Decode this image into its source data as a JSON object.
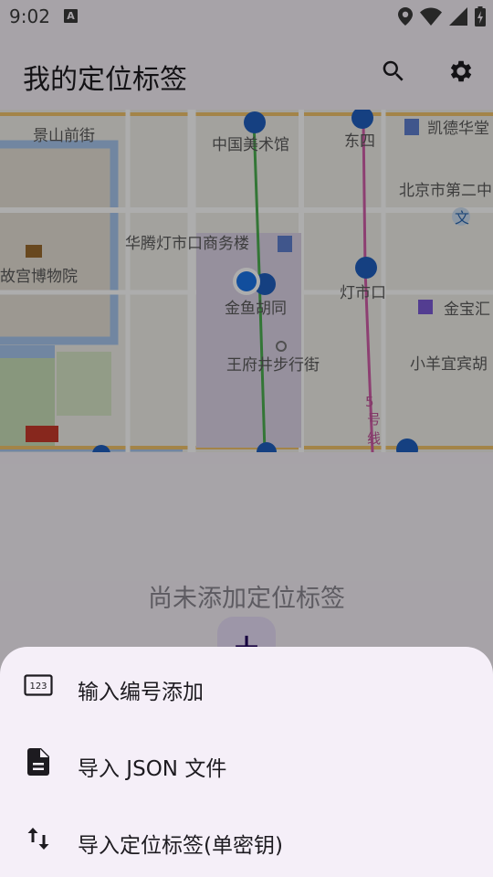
{
  "status_bar": {
    "time": "9:02",
    "indicator": "A"
  },
  "app_bar": {
    "title": "我的定位标签",
    "actions": [
      "search-icon",
      "gear-icon"
    ]
  },
  "map": {
    "labels": {
      "jingshan_front_street": "景山前街",
      "china_art_museum": "中国美术馆",
      "dongsi": "东四",
      "kaide_plaza": "凯德华堂",
      "beijing_no2_school": "北京市第二中",
      "wen": "文",
      "huateng": "华腾灯市口商务楼",
      "palace_museum": "故宫博物院",
      "dengshikou": "灯市口",
      "jinyu_hutong": "金鱼胡同",
      "jinbao": "金宝汇",
      "wangfujing": "王府井步行街",
      "xiaoyang": "小羊宜宾胡",
      "line5_a": "5",
      "line5_b": "号",
      "line5_c": "线"
    }
  },
  "empty_state": {
    "message": "尚未添加定位标签",
    "fab_symbol": "+"
  },
  "bottom_sheet": {
    "items": [
      {
        "icon": "numeric-keypad-icon",
        "label": "输入编号添加"
      },
      {
        "icon": "document-icon",
        "label": "导入 JSON 文件"
      },
      {
        "icon": "swap-vertical-icon",
        "label": "导入定位标签(单密钥)"
      }
    ]
  },
  "colors": {
    "surface": "#f6f1f8",
    "sheet": "#f5eff8",
    "fab": "#e8def8",
    "scrim": "rgba(0,0,0,0.32)",
    "location_dot": "#1a73e8"
  }
}
